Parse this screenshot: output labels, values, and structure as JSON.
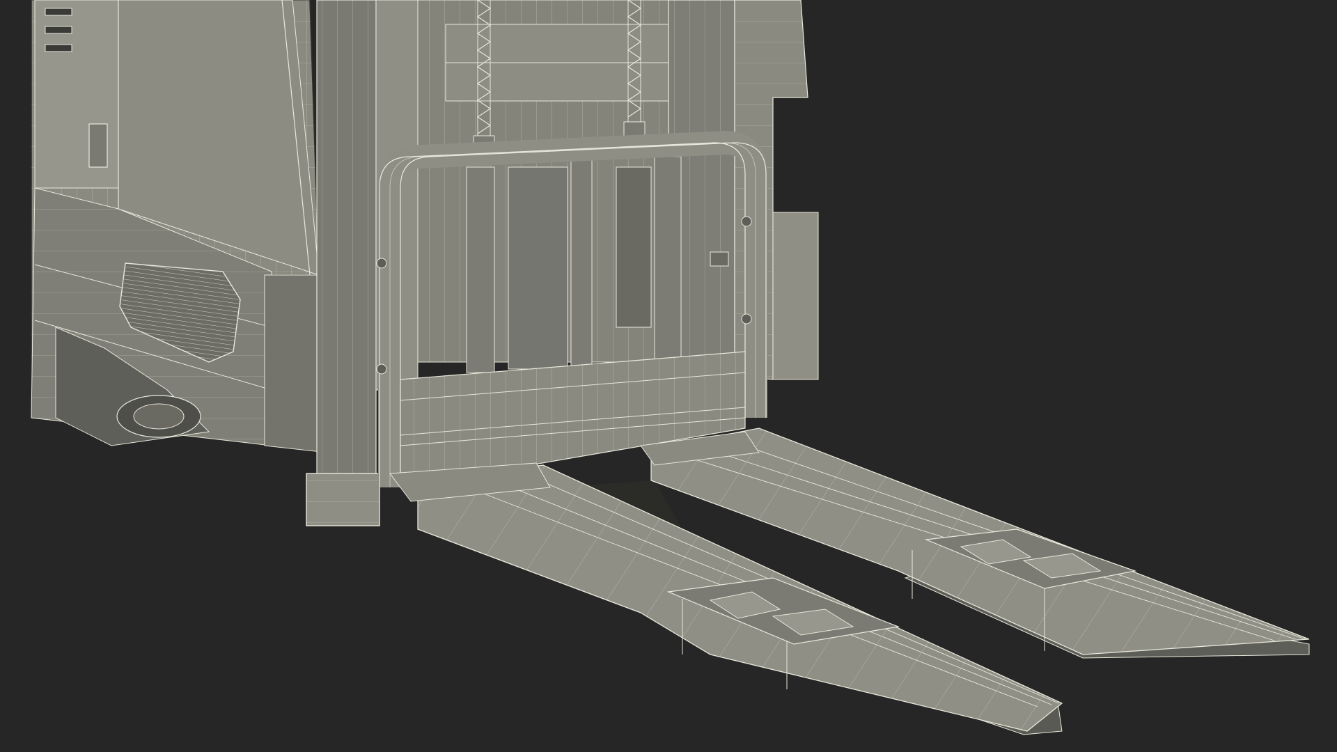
{
  "scene": {
    "subject": "pallet-stacker-wireframe-render",
    "background_color": "#262626",
    "body_fill": "#8e8e85",
    "body_shadow_fill": "#6f6f68",
    "body_light_fill": "#a3a39a",
    "wire_color": "#e8e8dc",
    "outline_color": "#2e2e2a"
  }
}
